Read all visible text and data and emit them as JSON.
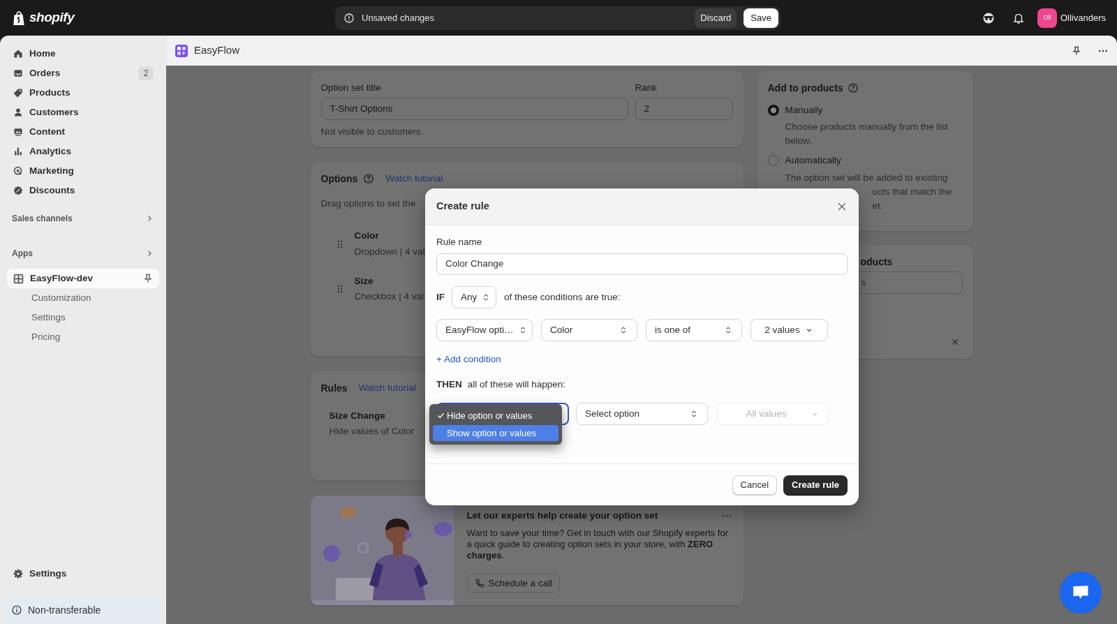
{
  "topbar": {
    "brand": "shopify",
    "save_bar": {
      "message": "Unsaved changes",
      "discard": "Discard",
      "save": "Save"
    },
    "store": {
      "initials": "Oll",
      "name": "Ollivanders"
    }
  },
  "sidebar": {
    "items": [
      {
        "label": "Home",
        "selected": false
      },
      {
        "label": "Orders",
        "badge": "2",
        "selected": false
      },
      {
        "label": "Products",
        "selected": false
      },
      {
        "label": "Customers",
        "selected": false
      },
      {
        "label": "Content",
        "selected": false
      },
      {
        "label": "Analytics",
        "selected": false
      },
      {
        "label": "Marketing",
        "selected": false
      },
      {
        "label": "Discounts",
        "selected": false
      }
    ],
    "sections": [
      "Sales channels",
      "Apps"
    ],
    "apps": [
      {
        "label": "EasyFlow-dev",
        "selected": true,
        "children": [
          {
            "label": "Customization",
            "selected": false
          },
          {
            "label": "Settings",
            "selected": false
          },
          {
            "label": "Pricing",
            "selected": false
          }
        ]
      }
    ],
    "settings": "Settings",
    "notice": "Non-transferable"
  },
  "app_header": {
    "title": "EasyFlow"
  },
  "option_set_card": {
    "title_label": "Option set title",
    "title_value": "T-Shirt Options",
    "rank_label": "Rank",
    "rank_value": "2",
    "help": "Not visible to customers."
  },
  "options_card": {
    "title": "Options",
    "link": "Watch tutorial",
    "hint": "Drag options to set the",
    "options": [
      {
        "name": "Color",
        "detail": "Dropdown | 4 val"
      },
      {
        "name": "Size",
        "detail": "Checkbox | 4 val"
      }
    ]
  },
  "rules_card": {
    "title": "Rules",
    "link": "Watch tutorial",
    "rules": [
      {
        "name": "Size Change",
        "detail": "Hide values of Color"
      }
    ]
  },
  "experts_card": {
    "title": "Let our experts help create your option set",
    "body": "Want to save your time? Get in touch with our Shopify experts for a quick guide to creating option sets in your store, with **ZERO charges**.",
    "button": "Schedule a call"
  },
  "add_to_products_card": {
    "title": "Add to products",
    "choices": [
      {
        "label": "Manually",
        "lines": [
          "Choose products manually from the list below."
        ],
        "selected": true
      },
      {
        "label": "Automatically",
        "lines": [
          "The option set will be added to existing",
          "ucts that match the",
          "et."
        ],
        "selected": false
      }
    ]
  },
  "products_card": {
    "title": "oducts",
    "field_value": "s"
  },
  "modal": {
    "title": "Create rule",
    "rule_name_label": "Rule name",
    "rule_name_value": "Color Change",
    "if_label": "IF",
    "match": "Any",
    "conditions_text": "of these conditions are true:",
    "conditions": [
      {
        "source": "EasyFlow opti…",
        "option": "Color",
        "operator": "is one of",
        "values": "2 values"
      }
    ],
    "add_condition": "+ Add condition",
    "then_label": "THEN",
    "then_text": "all of these will happen:",
    "actions": [
      {
        "option": "Select option",
        "values": "All values",
        "values_disabled": true
      }
    ],
    "menu": [
      {
        "label": "Hide option or values",
        "checked": true,
        "highlighted": false
      },
      {
        "label": "Show option or values",
        "checked": false,
        "highlighted": true
      }
    ],
    "cancel": "Cancel",
    "create": "Create rule"
  }
}
